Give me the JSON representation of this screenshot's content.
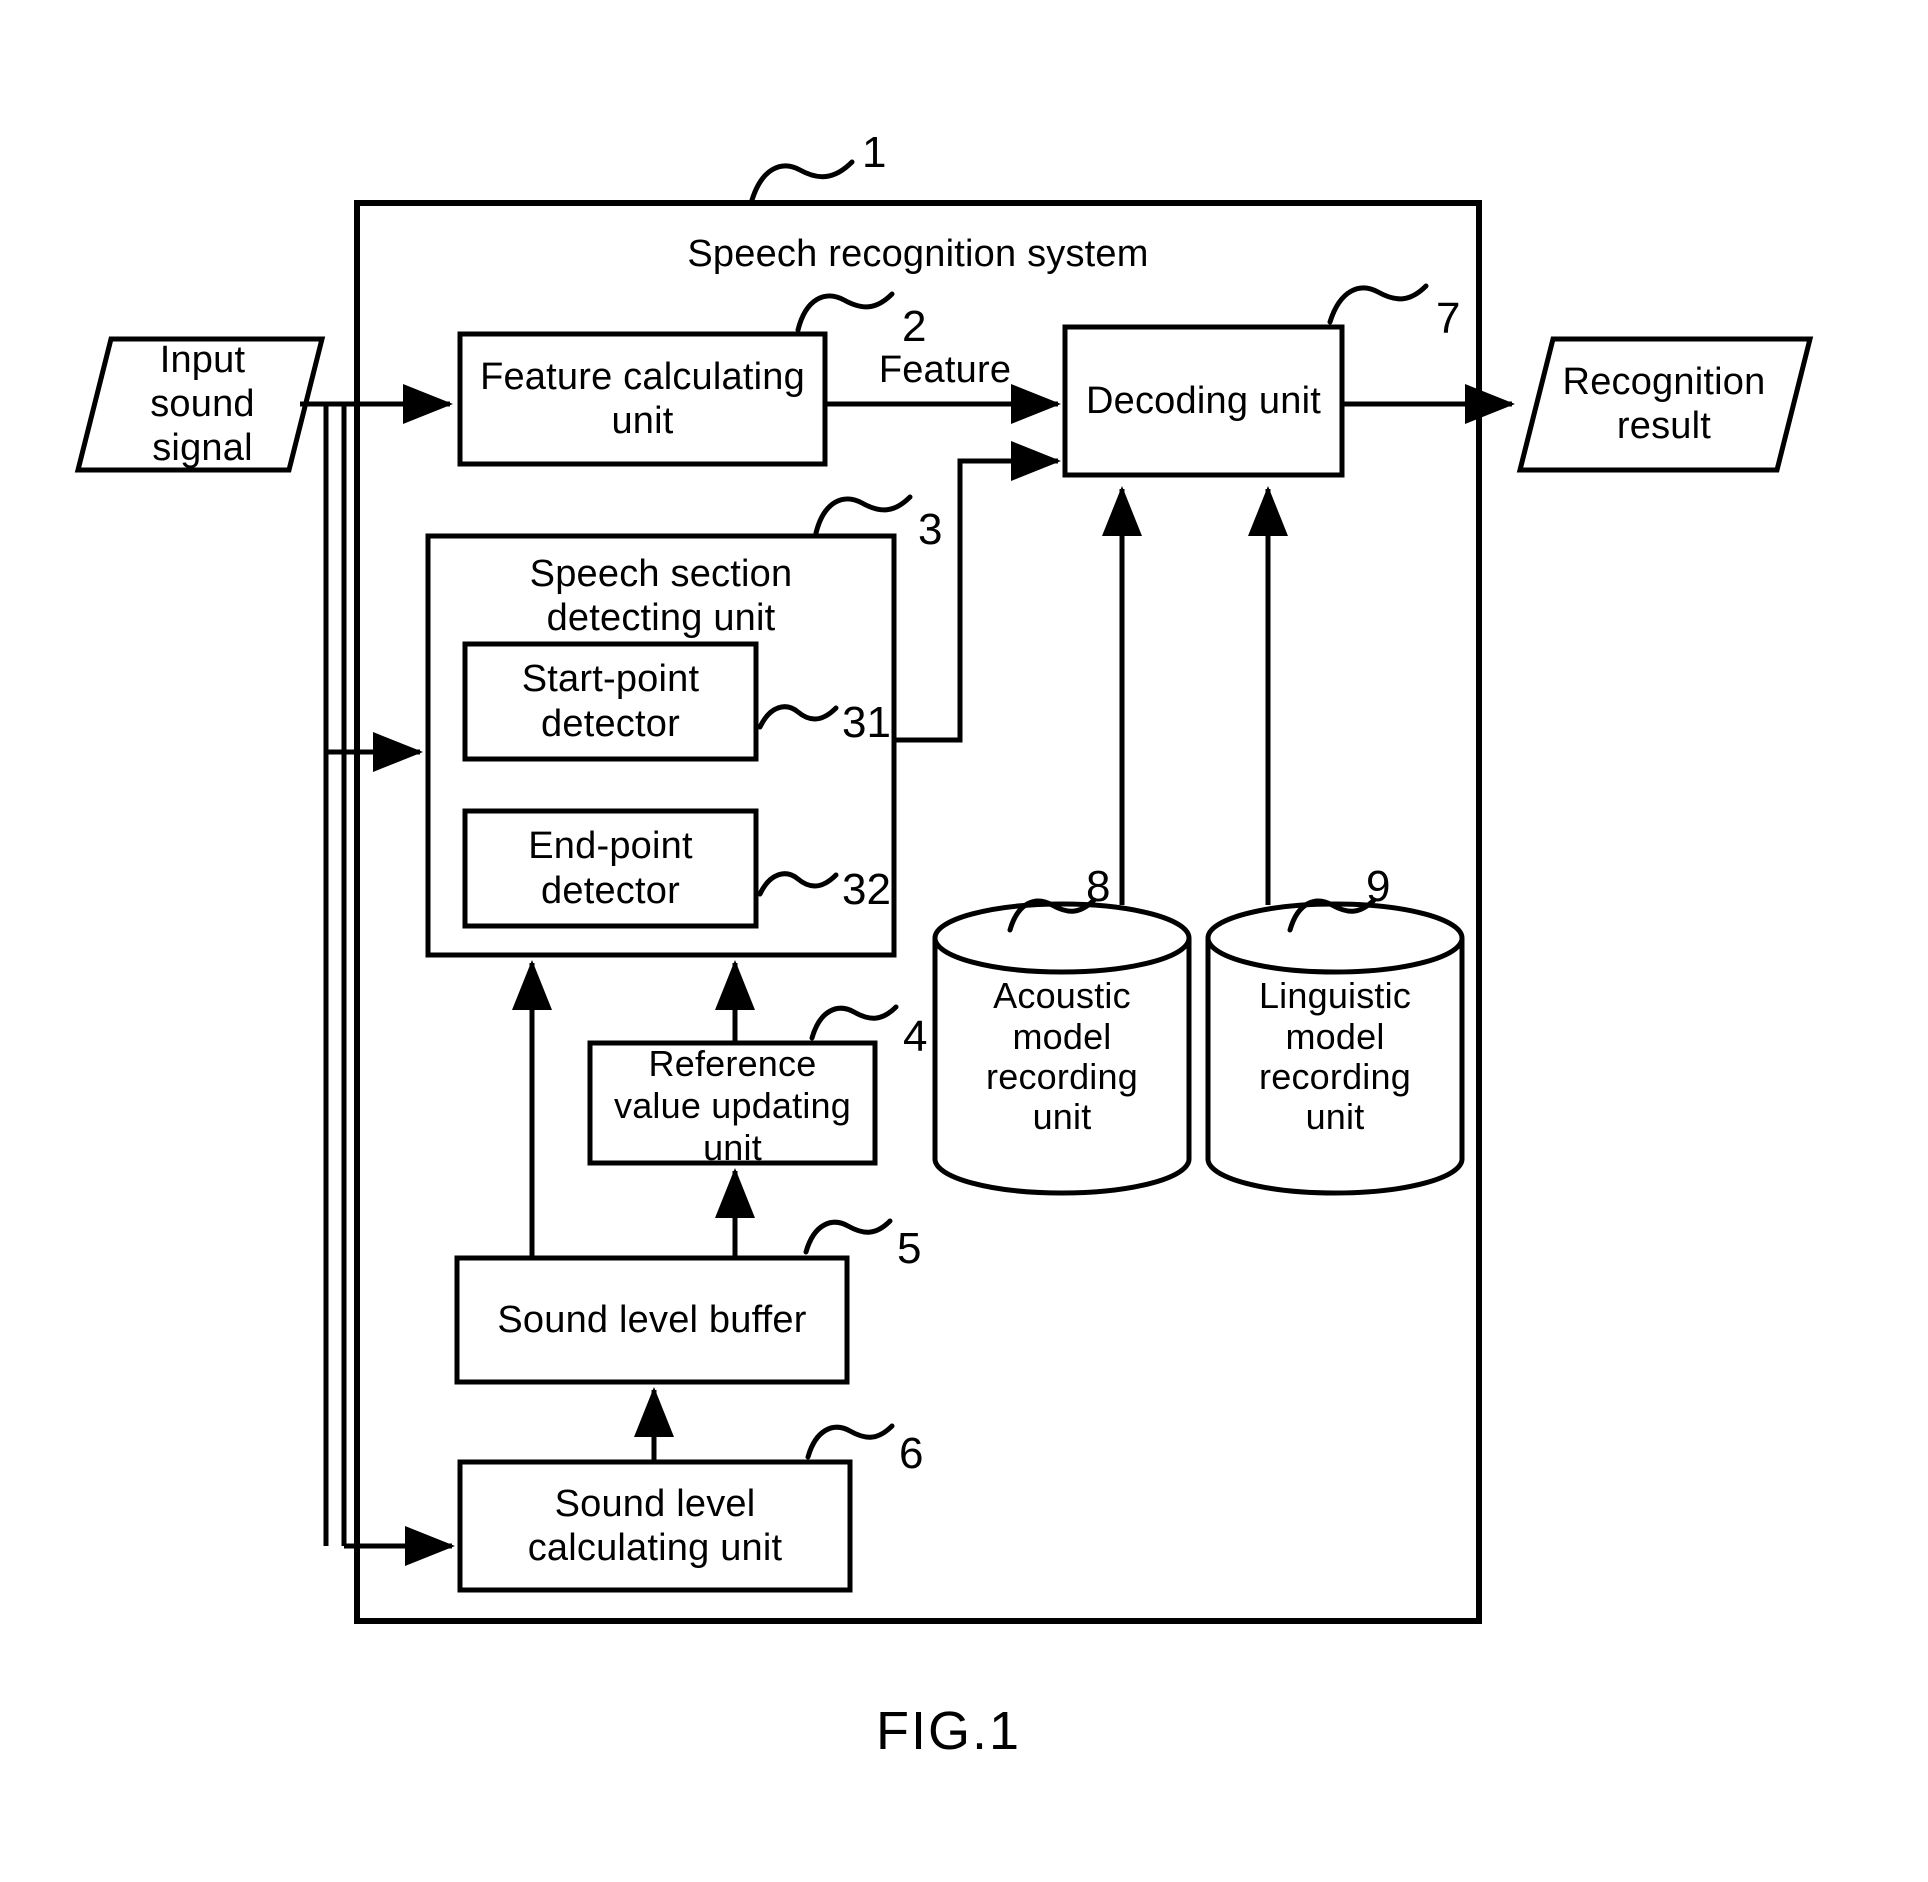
{
  "figure": {
    "caption": "FIG.1",
    "system_title": "Speech recognition system",
    "system_ref": "1"
  },
  "io": {
    "input": {
      "label": "Input\nsound\nsignal",
      "name": "input-sound-signal"
    },
    "output": {
      "label": "Recognition\nresult",
      "name": "recognition-result"
    }
  },
  "blocks": [
    {
      "id": "feature_calculating_unit",
      "label": "Feature calculating\nunit",
      "ref": "2"
    },
    {
      "id": "decoding_unit",
      "label": "Decoding unit",
      "ref": "7"
    },
    {
      "id": "speech_section_detecting_unit",
      "label": "Speech section\ndetecting unit",
      "ref": "3"
    },
    {
      "id": "start_point_detector",
      "label": "Start-point\ndetector",
      "ref": "31"
    },
    {
      "id": "end_point_detector",
      "label": "End-point\ndetector",
      "ref": "32"
    },
    {
      "id": "reference_value_updating_unit",
      "label": "Reference\nvalue updating\nunit",
      "ref": "4"
    },
    {
      "id": "sound_level_buffer",
      "label": "Sound level buffer",
      "ref": "5"
    },
    {
      "id": "sound_level_calculating_unit",
      "label": "Sound level\ncalculating unit",
      "ref": "6"
    }
  ],
  "stores": [
    {
      "id": "acoustic_model_recording_unit",
      "label": "Acoustic\nmodel\nrecording\nunit",
      "ref": "8"
    },
    {
      "id": "linguistic_model_recording_unit",
      "label": "Linguistic\nmodel\nrecording\nunit",
      "ref": "9"
    }
  ],
  "edges": [
    {
      "id": "feature_edge",
      "label": "Feature"
    }
  ],
  "chart_data": {
    "type": "diagram",
    "title": "Speech recognition system",
    "nodes": [
      {
        "ref": "1",
        "name": "Speech recognition system",
        "shape": "container"
      },
      {
        "ref": "2",
        "name": "Feature calculating unit",
        "shape": "rect"
      },
      {
        "ref": "3",
        "name": "Speech section detecting unit",
        "shape": "rect"
      },
      {
        "ref": "31",
        "name": "Start-point detector",
        "shape": "rect"
      },
      {
        "ref": "32",
        "name": "End-point detector",
        "shape": "rect"
      },
      {
        "ref": "4",
        "name": "Reference value updating unit",
        "shape": "rect"
      },
      {
        "ref": "5",
        "name": "Sound level buffer",
        "shape": "rect"
      },
      {
        "ref": "6",
        "name": "Sound level calculating unit",
        "shape": "rect"
      },
      {
        "ref": "7",
        "name": "Decoding unit",
        "shape": "rect"
      },
      {
        "ref": "8",
        "name": "Acoustic model recording unit",
        "shape": "cylinder"
      },
      {
        "ref": "9",
        "name": "Linguistic model recording unit",
        "shape": "cylinder"
      },
      {
        "ref": "",
        "name": "Input sound signal",
        "shape": "parallelogram"
      },
      {
        "ref": "",
        "name": "Recognition result",
        "shape": "parallelogram"
      }
    ],
    "links": [
      {
        "from": "Input sound signal",
        "to": "Feature calculating unit",
        "label": ""
      },
      {
        "from": "Input sound signal",
        "to": "Speech section detecting unit",
        "label": ""
      },
      {
        "from": "Input sound signal",
        "to": "Sound level calculating unit",
        "label": ""
      },
      {
        "from": "Feature calculating unit",
        "to": "Decoding unit",
        "label": "Feature"
      },
      {
        "from": "Start-point detector",
        "to": "Decoding unit",
        "label": ""
      },
      {
        "from": "Decoding unit",
        "to": "Recognition result",
        "label": ""
      },
      {
        "from": "Acoustic model recording unit",
        "to": "Decoding unit",
        "label": ""
      },
      {
        "from": "Linguistic model recording unit",
        "to": "Decoding unit",
        "label": ""
      },
      {
        "from": "Sound level calculating unit",
        "to": "Sound level buffer",
        "label": ""
      },
      {
        "from": "Sound level buffer",
        "to": "Reference value updating unit",
        "label": ""
      },
      {
        "from": "Sound level buffer",
        "to": "Speech section detecting unit",
        "label": ""
      },
      {
        "from": "Reference value updating unit",
        "to": "Speech section detecting unit",
        "label": ""
      }
    ]
  }
}
